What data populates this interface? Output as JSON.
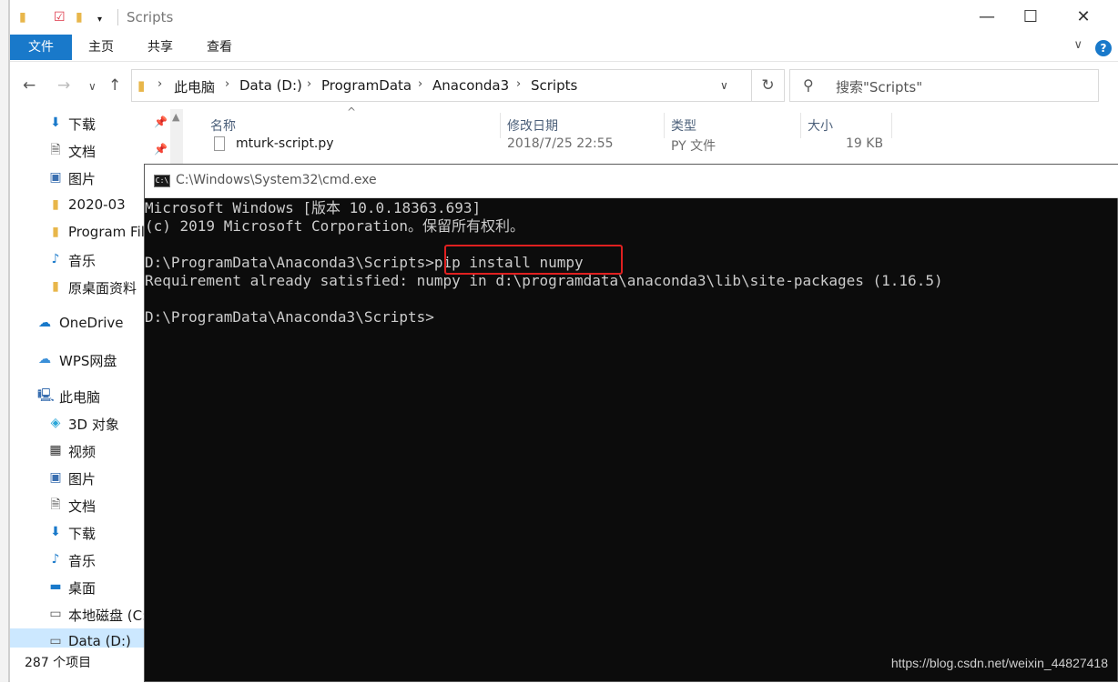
{
  "explorer": {
    "title": "Scripts",
    "ribbon_tabs": [
      "文件",
      "主页",
      "共享",
      "查看"
    ],
    "help_label": "?",
    "breadcrumb": [
      "此电脑",
      "Data (D:)",
      "ProgramData",
      "Anaconda3",
      "Scripts"
    ],
    "search_placeholder": "搜索\"Scripts\"",
    "columns": [
      "名称",
      "修改日期",
      "类型",
      "大小"
    ],
    "file": {
      "name": "mturk-script.py",
      "date": "2018/7/25 22:55",
      "type": "PY 文件",
      "size": "19 KB"
    },
    "sidebar": [
      {
        "label": "下载",
        "icon": "download-arrow-icon",
        "pinned": true
      },
      {
        "label": "文档",
        "icon": "document-icon",
        "pinned": true
      },
      {
        "label": "图片",
        "icon": "picture-icon",
        "pinned": true
      },
      {
        "label": "2020-03",
        "icon": "folder-icon"
      },
      {
        "label": "Program File",
        "icon": "folder-icon"
      },
      {
        "label": "音乐",
        "icon": "music-note-icon"
      },
      {
        "label": "原桌面资料",
        "icon": "folder-icon"
      },
      {
        "label": "OneDrive",
        "icon": "cloud-icon"
      },
      {
        "label": "WPS网盘",
        "icon": "cloud-outline-icon"
      },
      {
        "label": "此电脑",
        "icon": "computer-icon"
      },
      {
        "label": "3D 对象",
        "icon": "cube-icon"
      },
      {
        "label": "视频",
        "icon": "video-icon"
      },
      {
        "label": "图片",
        "icon": "picture-icon"
      },
      {
        "label": "文档",
        "icon": "document-icon"
      },
      {
        "label": "下载",
        "icon": "download-arrow-icon"
      },
      {
        "label": "音乐",
        "icon": "music-note-icon"
      },
      {
        "label": "桌面",
        "icon": "desktop-icon"
      },
      {
        "label": "本地磁盘 (C:)",
        "icon": "drive-icon"
      },
      {
        "label": "Data (D:)",
        "icon": "drive-icon",
        "selected": true
      }
    ],
    "status": "287 个项目"
  },
  "cmd": {
    "title": "C:\\Windows\\System32\\cmd.exe",
    "icon_text": "C:\\",
    "lines": [
      "Microsoft Windows [版本 10.0.18363.693]",
      "(c) 2019 Microsoft Corporation。保留所有权利。",
      "",
      "D:\\ProgramData\\Anaconda3\\Scripts>pip install numpy",
      "Requirement already satisfied: numpy in d:\\programdata\\anaconda3\\lib\\site-packages (1.16.5)",
      "",
      "D:\\ProgramData\\Anaconda3\\Scripts>"
    ],
    "highlight_color": "#e02020"
  },
  "watermark": "https://blog.csdn.net/weixin_44827418",
  "colors": {
    "accent": "#1979ca",
    "console_bg": "#0c0c0c",
    "console_fg": "#cccccc",
    "selection": "#cce8ff"
  }
}
